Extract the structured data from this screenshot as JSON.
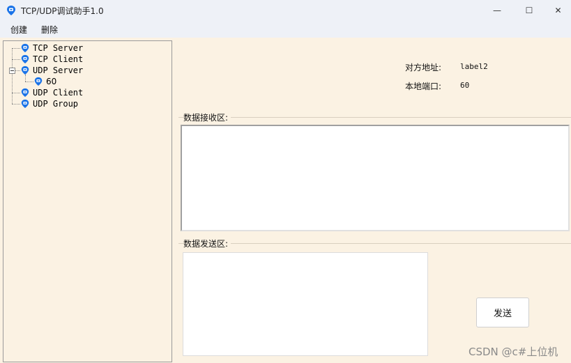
{
  "window": {
    "title": "TCP/UDP调试助手1.0",
    "controls": {
      "minimize": "—",
      "maximize": "☐",
      "close": "✕"
    }
  },
  "menu": {
    "items": [
      "创建",
      "删除"
    ]
  },
  "tree": {
    "nodes": [
      {
        "label": "TCP Server",
        "icon": "phone-pin-icon"
      },
      {
        "label": "TCP Client",
        "icon": "phone-pin-icon"
      },
      {
        "label": "UDP Server",
        "icon": "phone-pin-icon",
        "expanded": true
      },
      {
        "label": "60",
        "icon": "phone-pin-icon"
      },
      {
        "label": "UDP Client",
        "icon": "phone-pin-icon"
      },
      {
        "label": "UDP Group",
        "icon": "phone-pin-icon"
      }
    ]
  },
  "info": {
    "remote_address_label": "对方地址:",
    "remote_address_value": "label2",
    "local_port_label": "本地端口:",
    "local_port_value": "60"
  },
  "receive": {
    "title": "数据接收区:"
  },
  "send": {
    "title": "数据发送区:",
    "button": "发送"
  },
  "watermark": "CSDN @c#上位机",
  "colors": {
    "accent": "#1a73e8",
    "panel_bg": "#fbf2e3",
    "titlebar_bg": "#eef1f7"
  }
}
